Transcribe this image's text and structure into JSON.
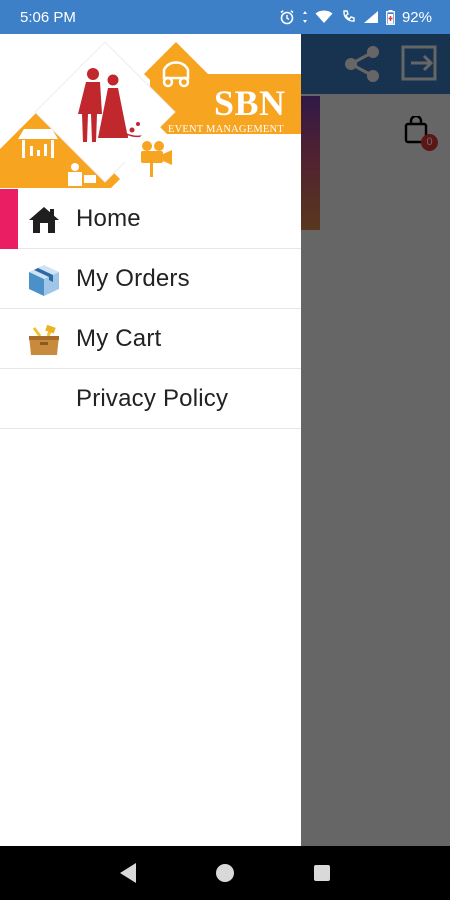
{
  "status_bar": {
    "time": "5:06 PM",
    "battery": "92%",
    "icons": [
      "alarm-icon",
      "wifi-icon",
      "data-transfer-icon",
      "signal-icon",
      "battery-icon"
    ]
  },
  "background_app": {
    "toolbar_icons": [
      "share-icon",
      "exit-icon"
    ],
    "cart_count": "0"
  },
  "drawer": {
    "brand": {
      "name": "SBN",
      "tagline": "EVENT MANAGEMENT"
    },
    "menu": [
      {
        "label": "Home",
        "icon": "home-icon",
        "active": true
      },
      {
        "label": "My Orders",
        "icon": "orders-box-icon",
        "active": false
      },
      {
        "label": "My Cart",
        "icon": "cart-box-icon",
        "active": false
      },
      {
        "label": "Privacy Policy",
        "icon": "",
        "active": false
      }
    ]
  },
  "nav_bar": {
    "buttons": [
      "back-button",
      "home-button",
      "recents-button"
    ]
  },
  "colors": {
    "primary": "#3e80c7",
    "accent": "#e91e63",
    "brand_orange": "#f7a421",
    "brand_red": "#c0282d"
  }
}
